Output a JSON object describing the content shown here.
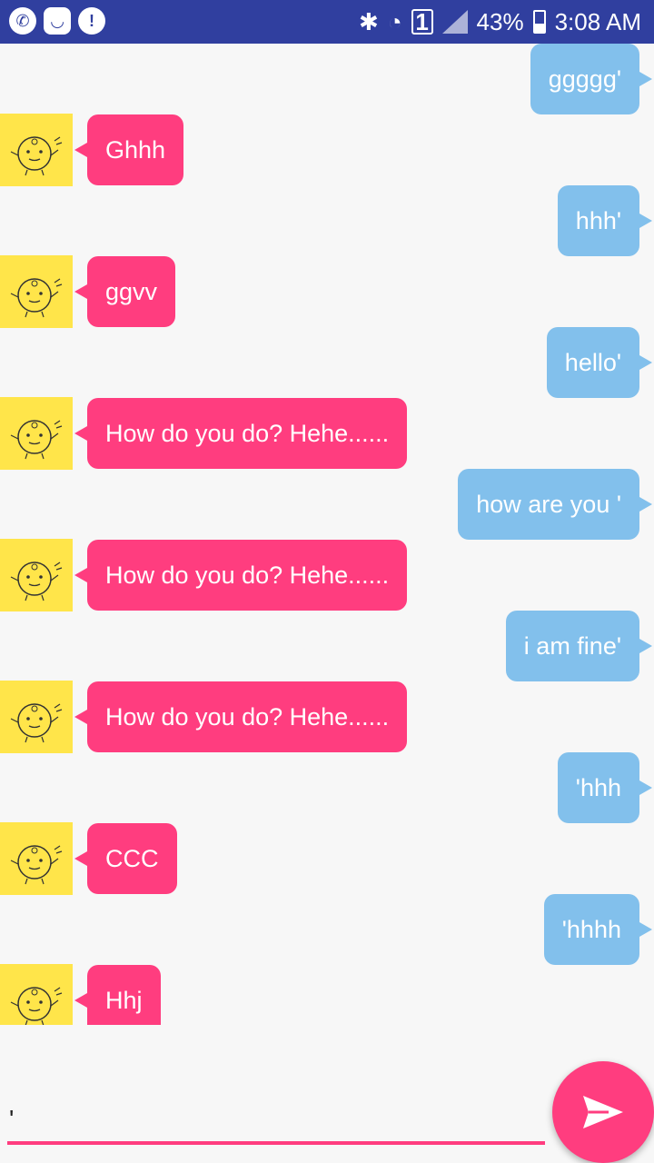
{
  "status_bar": {
    "battery_percent": "43%",
    "time": "3:08 AM",
    "sim_slot": "1",
    "colors": {
      "background": "#303f9f",
      "foreground": "#ffffff"
    },
    "icons": [
      "whatsapp-icon",
      "app-icon",
      "chat-alert-icon",
      "bluetooth-icon",
      "wifi-icon",
      "signal-icon",
      "battery-icon"
    ]
  },
  "messages": [
    {
      "sender": "me",
      "text": "ggggg'"
    },
    {
      "sender": "bot",
      "text": "Ghhh"
    },
    {
      "sender": "me",
      "text": "hhh'"
    },
    {
      "sender": "bot",
      "text": "ggvv"
    },
    {
      "sender": "me",
      "text": "hello'"
    },
    {
      "sender": "bot",
      "text": "How do you do? Hehe......"
    },
    {
      "sender": "me",
      "text": "how are you '"
    },
    {
      "sender": "bot",
      "text": "How do you do? Hehe......"
    },
    {
      "sender": "me",
      "text": "i am fine'"
    },
    {
      "sender": "bot",
      "text": "How do you do? Hehe......"
    },
    {
      "sender": "me",
      "text": "'hhh"
    },
    {
      "sender": "bot",
      "text": "CCC"
    },
    {
      "sender": "me",
      "text": "'hhhh"
    },
    {
      "sender": "bot",
      "text": "Hhj"
    }
  ],
  "composer": {
    "value": "'",
    "send_icon": "send-icon"
  },
  "colors": {
    "my_bubble": "#82c0ec",
    "bot_bubble": "#ff3d7f",
    "avatar_bg": "#ffe54a",
    "accent": "#ff3d7f"
  }
}
